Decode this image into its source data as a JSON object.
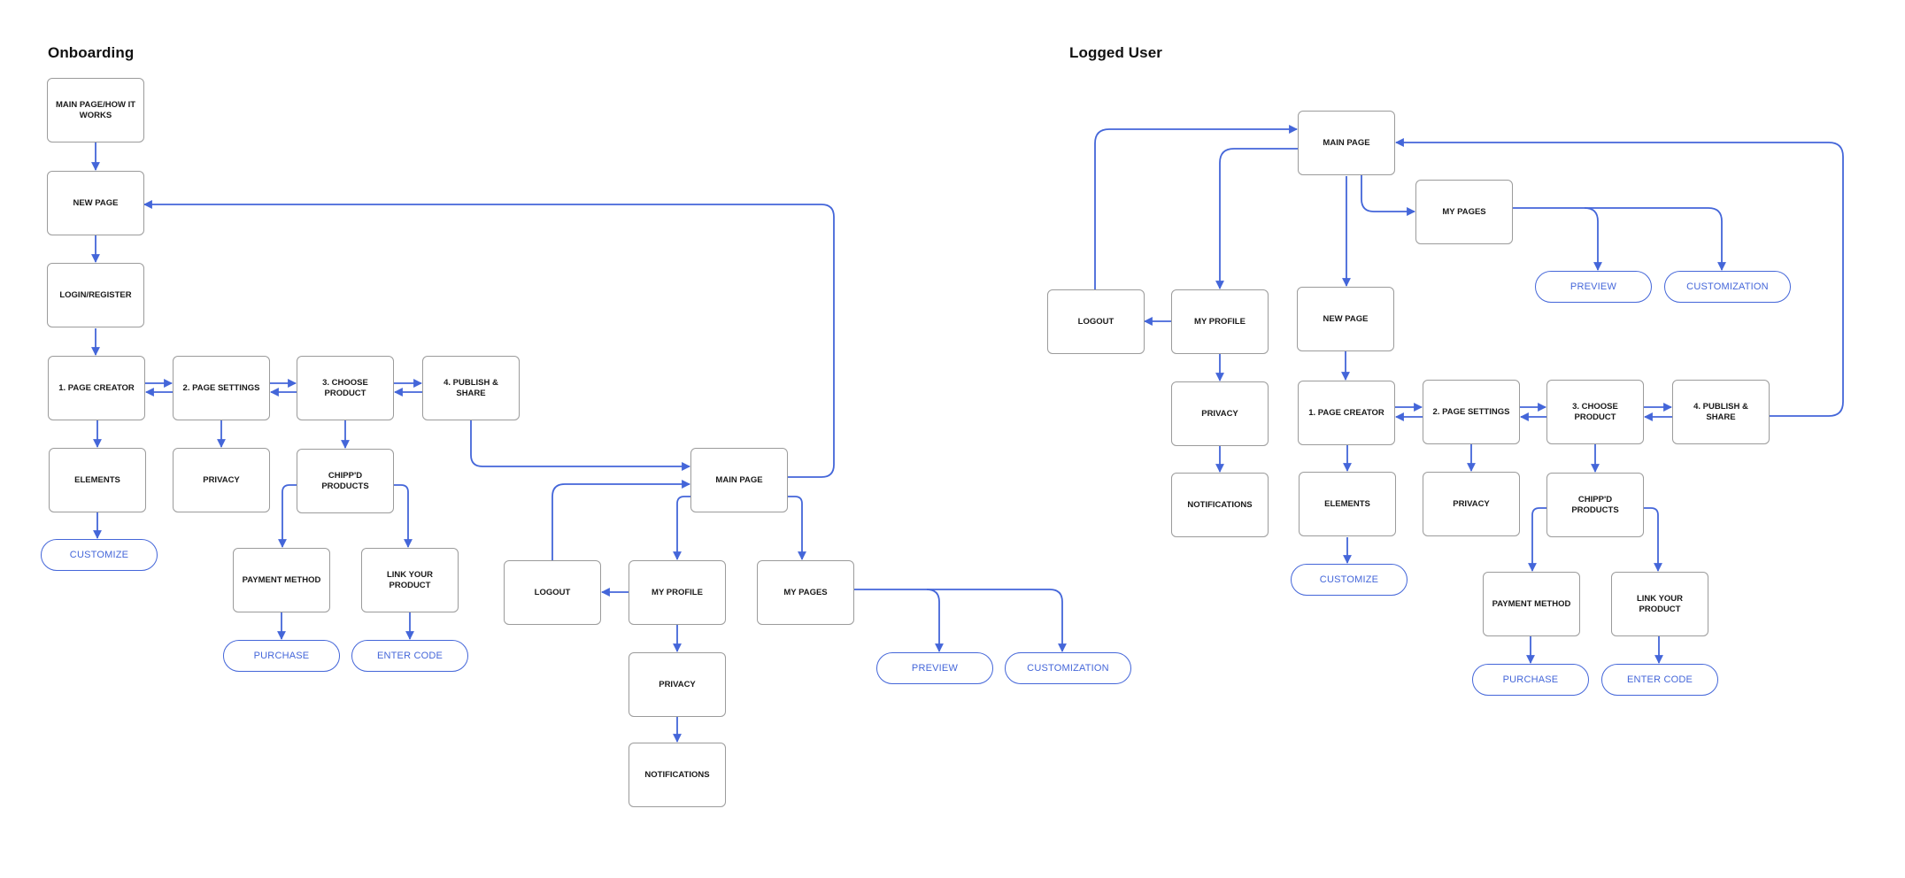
{
  "colors": {
    "connector": "#4466d9",
    "box_border": "#9b9b9b",
    "text": "#1a1a1a",
    "action_text": "#4466d9"
  },
  "onboarding": {
    "title": "Onboarding",
    "nodes": {
      "main_page_how_it_works": "MAIN PAGE/HOW IT WORKS",
      "new_page": "NEW PAGE",
      "login_register": "LOGIN/REGISTER",
      "page_creator": "1. PAGE CREATOR",
      "page_settings": "2. PAGE SETTINGS",
      "choose_product": "3. CHOOSE PRODUCT",
      "publish_share": "4. PUBLISH & SHARE",
      "elements": "ELEMENTS",
      "customize": "CUSTOMIZE",
      "privacy": "PRIVACY",
      "chippd_products": "CHIPP'D PRODUCTS",
      "payment_method": "PAYMENT METHOD",
      "link_your_product": "LINK YOUR PRODUCT",
      "purchase": "PURCHASE",
      "enter_code": "ENTER CODE",
      "main_page": "MAIN PAGE",
      "logout": "LOGOUT",
      "my_profile": "MY PROFILE",
      "my_pages": "MY PAGES",
      "profile_privacy": "PRIVACY",
      "notifications": "NOTIFICATIONS",
      "preview": "PREVIEW",
      "customization": "CUSTOMIZATION"
    }
  },
  "logged_user": {
    "title": "Logged User",
    "nodes": {
      "main_page": "MAIN PAGE",
      "my_pages": "MY PAGES",
      "preview": "PREVIEW",
      "customization": "CUSTOMIZATION",
      "logout": "LOGOUT",
      "my_profile": "MY PROFILE",
      "new_page": "NEW PAGE",
      "profile_privacy": "PRIVACY",
      "notifications": "NOTIFICATIONS",
      "page_creator": "1. PAGE CREATOR",
      "page_settings": "2. PAGE SETTINGS",
      "choose_product": "3. CHOOSE PRODUCT",
      "publish_share": "4. PUBLISH & SHARE",
      "elements": "ELEMENTS",
      "customize": "CUSTOMIZE",
      "privacy": "PRIVACY",
      "chippd_products": "CHIPP'D PRODUCTS",
      "payment_method": "PAYMENT METHOD",
      "link_your_product": "LINK YOUR PRODUCT",
      "purchase": "PURCHASE",
      "enter_code": "ENTER CODE"
    }
  }
}
